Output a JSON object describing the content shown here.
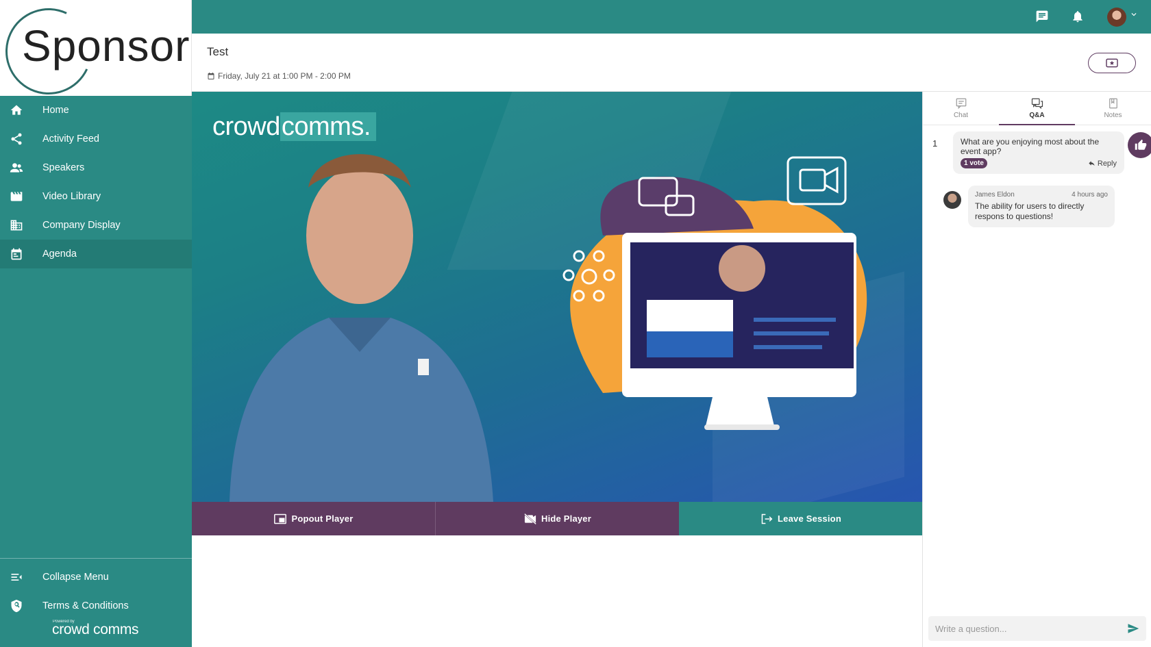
{
  "app": {
    "logo_text": "Sponsor",
    "powered_by": "Powered by",
    "powered_brand": "crowd comms"
  },
  "sidebar": {
    "items": [
      {
        "label": "Home",
        "icon": "home-icon"
      },
      {
        "label": "Activity Feed",
        "icon": "share-icon"
      },
      {
        "label": "Speakers",
        "icon": "people-icon"
      },
      {
        "label": "Video Library",
        "icon": "film-icon"
      },
      {
        "label": "Company Display",
        "icon": "building-icon"
      },
      {
        "label": "Agenda",
        "icon": "calendar-icon",
        "active": true
      }
    ],
    "bottom_items": [
      {
        "label": "Collapse Menu",
        "icon": "collapse-menu-icon"
      },
      {
        "label": "Terms & Conditions",
        "icon": "shield-icon"
      }
    ]
  },
  "topbar": {
    "icons": [
      "chat-icon",
      "bell-icon",
      "avatar",
      "chevron-down-icon"
    ]
  },
  "session": {
    "title": "Test",
    "date": "Friday, July 21 at 1:00 PM - 2:00 PM"
  },
  "video": {
    "brand_left": "crowd",
    "brand_right": "comms."
  },
  "controls": {
    "popout": "Popout Player",
    "hide": "Hide Player",
    "leave": "Leave Session"
  },
  "panel": {
    "tabs": [
      {
        "label": "Chat"
      },
      {
        "label": "Q&A",
        "active": true
      },
      {
        "label": "Notes"
      }
    ],
    "question": {
      "number": "1",
      "text": "What are you enjoying most about the event app?",
      "votes": "1 vote",
      "reply_label": "Reply"
    },
    "answer": {
      "author": "James Eldon",
      "time": "4 hours ago",
      "text": "The ability for users to directly respons to questions!"
    },
    "ask_placeholder": "Write a question..."
  },
  "colors": {
    "teal": "#2a8a84",
    "purple": "#5f3b60"
  }
}
